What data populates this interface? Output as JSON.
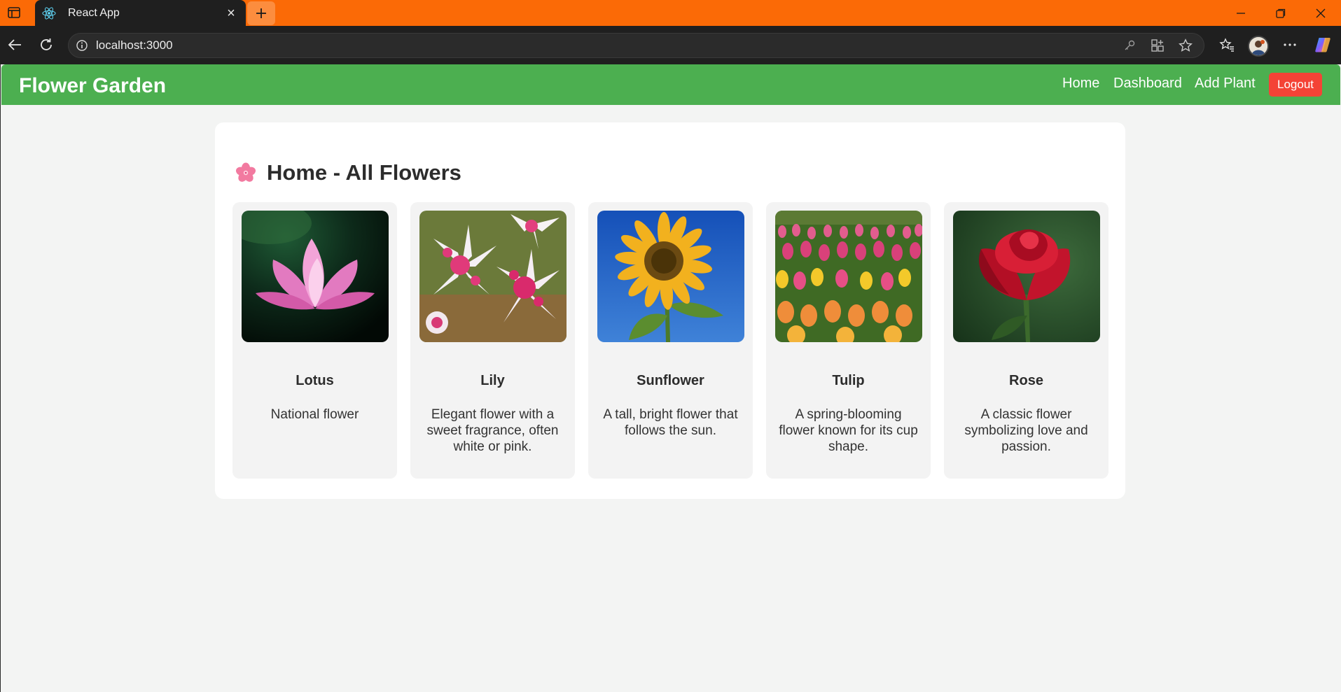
{
  "browser": {
    "tab_title": "React App",
    "url": "localhost:3000",
    "new_tab_label": "+",
    "tab_close_label": "×"
  },
  "navbar": {
    "brand": "Flower Garden",
    "links": [
      "Home",
      "Dashboard",
      "Add Plant"
    ],
    "logout_label": "Logout",
    "color": "#4caf50",
    "logout_color": "#f44336"
  },
  "page": {
    "heading": "Home - All Flowers",
    "heading_icon": "cherry-blossom-icon"
  },
  "flowers": [
    {
      "name": "Lotus",
      "description": "National flower"
    },
    {
      "name": "Lily",
      "description": "Elegant flower with a sweet fragrance, often white or pink."
    },
    {
      "name": "Sunflower",
      "description": "A tall, bright flower that follows the sun."
    },
    {
      "name": "Tulip",
      "description": "A spring-blooming flower known for its cup shape."
    },
    {
      "name": "Rose",
      "description": "A classic flower symbolizing love and passion."
    }
  ],
  "theme": {
    "titlebar": "#fb6a06",
    "chrome": "#1f1f1f"
  }
}
